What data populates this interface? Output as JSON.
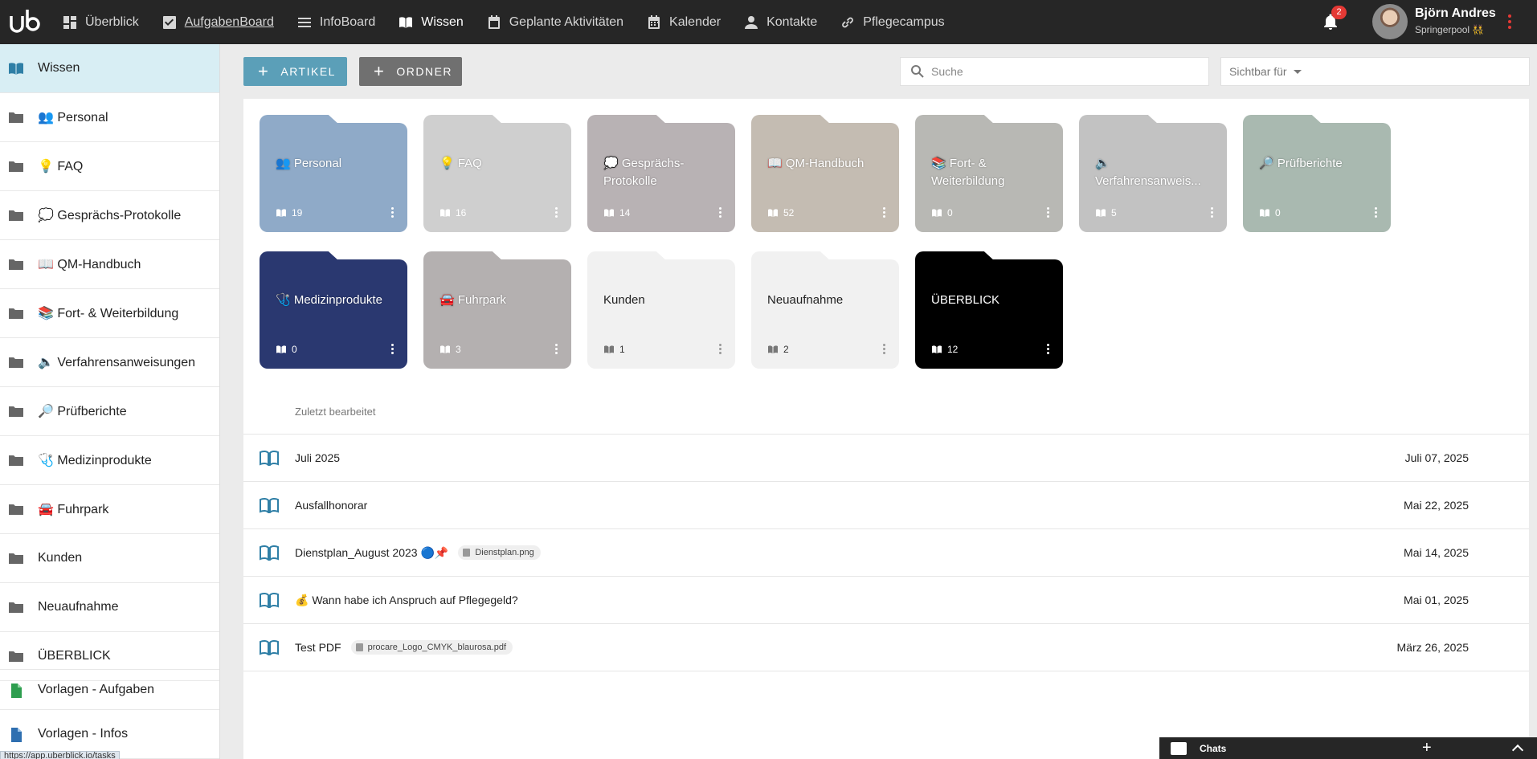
{
  "nav": {
    "items": [
      {
        "label": "Überblick",
        "icon": "dashboard-icon"
      },
      {
        "label": "AufgabenBoard",
        "icon": "checkbox-icon"
      },
      {
        "label": "InfoBoard",
        "icon": "list-icon"
      },
      {
        "label": "Wissen",
        "icon": "book-icon"
      },
      {
        "label": "Geplante Aktivitäten",
        "icon": "calendar-check-icon"
      },
      {
        "label": "Kalender",
        "icon": "calendar-icon"
      },
      {
        "label": "Kontakte",
        "icon": "person-icon"
      },
      {
        "label": "Pflegecampus",
        "icon": "link-icon"
      }
    ],
    "notification_count": "2",
    "user_name": "Björn Andres",
    "user_sub": "Springerpool 👯"
  },
  "sidebar": {
    "items": [
      {
        "label": "Wissen"
      },
      {
        "label": "👥 Personal"
      },
      {
        "label": "💡 FAQ"
      },
      {
        "label": "💭 Gesprächs-Protokolle"
      },
      {
        "label": "📖 QM-Handbuch"
      },
      {
        "label": "📚 Fort- & Weiterbildung"
      },
      {
        "label": "🔈 Verfahrensanweisungen"
      },
      {
        "label": "🔎 Prüfberichte"
      },
      {
        "label": "🩺 Medizinprodukte"
      },
      {
        "label": "🚘 Fuhrpark"
      },
      {
        "label": "Kunden"
      },
      {
        "label": "Neuaufnahme"
      },
      {
        "label": "ÜBERBLICK"
      }
    ],
    "templates": [
      {
        "label": "Vorlagen - Aufgaben"
      },
      {
        "label": "Vorlagen - Infos"
      }
    ],
    "status_url": "https://app.uberblick.io/tasks"
  },
  "toolbar": {
    "article_label": "ARTIKEL",
    "folder_label": "ORDNER",
    "search_placeholder": "Suche",
    "visibility_label": "Sichtbar für"
  },
  "folders": [
    {
      "title": "👥 Personal",
      "count": "19",
      "color": "#8faac8"
    },
    {
      "title": "💡 FAQ",
      "count": "16",
      "color": "#cfcfcf"
    },
    {
      "title": "💭 Gesprächs-Protokolle",
      "count": "14",
      "color": "#b8b2b4"
    },
    {
      "title": "📖 QM-Handbuch",
      "count": "52",
      "color": "#c4bcb2"
    },
    {
      "title": "📚 Fort- & Weiterbildung",
      "count": "0",
      "color": "#b8b8b4"
    },
    {
      "title": "🔈 Verfahrensanweis...",
      "count": "5",
      "color": "#c2c2c2"
    },
    {
      "title": "🔎 Prüfberichte",
      "count": "0",
      "color": "#a9b9b0"
    },
    {
      "title": "🩺 Medizinprodukte",
      "count": "0",
      "color": "#2a3870"
    },
    {
      "title": "🚘 Fuhrpark",
      "count": "3",
      "color": "#b4b0b0"
    },
    {
      "title": "Kunden",
      "count": "1",
      "color": "#f1f1f1"
    },
    {
      "title": "Neuaufnahme",
      "count": "2",
      "color": "#f1f1f1"
    },
    {
      "title": "ÜBERBLICK",
      "count": "12",
      "color": "#000000"
    }
  ],
  "recent": {
    "title": "Zuletzt bearbeitet",
    "rows": [
      {
        "title": "Juli 2025",
        "attachment": "",
        "date": "Juli 07, 2025"
      },
      {
        "title": "Ausfallhonorar",
        "attachment": "",
        "date": "Mai 22, 2025"
      },
      {
        "title": "Dienstplan_August 2023 🔵📌",
        "attachment": "Dienstplan.png",
        "date": "Mai 14, 2025"
      },
      {
        "title": "💰 Wann habe ich Anspruch auf Pflegegeld?",
        "attachment": "",
        "date": "Mai 01, 2025"
      },
      {
        "title": "Test PDF",
        "attachment": "procare_Logo_CMYK_blaurosa.pdf",
        "date": "März 26, 2025"
      }
    ]
  },
  "chats": {
    "label": "Chats"
  },
  "colors": {
    "topbar": "#262626",
    "accent": "#5b9fb8",
    "secondary_button": "#707070",
    "active_sidebar": "#d8eef4"
  }
}
